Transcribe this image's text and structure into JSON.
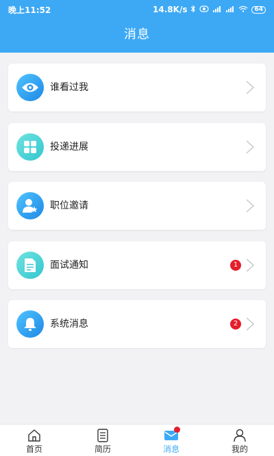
{
  "status_bar": {
    "time": "晚上11:52",
    "speed": "14.8K/s",
    "battery": "64"
  },
  "header": {
    "title": "消息"
  },
  "items": [
    {
      "label": "谁看过我",
      "icon": "eye-icon",
      "badge": ""
    },
    {
      "label": "投递进展",
      "icon": "grid-icon",
      "badge": ""
    },
    {
      "label": "职位邀请",
      "icon": "user-star-icon",
      "badge": ""
    },
    {
      "label": "面试通知",
      "icon": "document-icon",
      "badge": "1"
    },
    {
      "label": "系统消息",
      "icon": "bell-icon",
      "badge": "2"
    }
  ],
  "tabs": [
    {
      "label": "首页",
      "icon": "home-icon"
    },
    {
      "label": "简历",
      "icon": "resume-icon"
    },
    {
      "label": "消息",
      "icon": "mail-icon",
      "active": true
    },
    {
      "label": "我的",
      "icon": "person-icon"
    }
  ],
  "colors": {
    "accent": "#3da9f5",
    "badge": "#e41e2b",
    "background": "#f2f2f4"
  }
}
